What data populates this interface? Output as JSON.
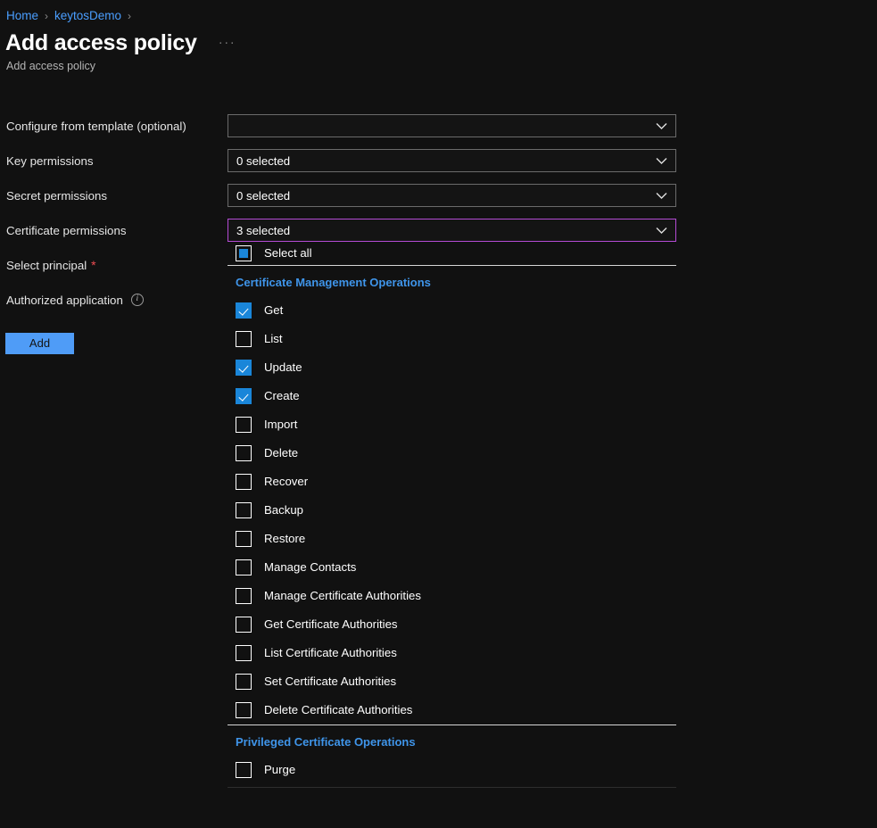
{
  "breadcrumb": {
    "items": [
      {
        "label": "Home"
      },
      {
        "label": "keytosDemo"
      }
    ],
    "separator": "›"
  },
  "header": {
    "title": "Add access policy",
    "subtitle": "Add access policy",
    "ellipsis": "···"
  },
  "form": {
    "rows": [
      {
        "label": "Configure from template (optional)",
        "value": "",
        "required": false,
        "has_info": false,
        "focused": false
      },
      {
        "label": "Key permissions",
        "value": "0 selected",
        "required": false,
        "has_info": false,
        "focused": false
      },
      {
        "label": "Secret permissions",
        "value": "0 selected",
        "required": false,
        "has_info": false,
        "focused": false
      },
      {
        "label": "Certificate permissions",
        "value": "3 selected",
        "required": false,
        "has_info": false,
        "focused": true
      },
      {
        "label": "Select principal",
        "value": null,
        "required": true,
        "has_info": false,
        "focused": false
      },
      {
        "label": "Authorized application",
        "value": null,
        "required": false,
        "has_info": true,
        "focused": false
      }
    ],
    "required_marker": "*",
    "info_glyph": "i",
    "add_label": "Add"
  },
  "certificate_permissions_panel": {
    "select_all": {
      "label": "Select all",
      "state": "indeterminate"
    },
    "groups": [
      {
        "title": "Certificate Management Operations",
        "options": [
          {
            "label": "Get",
            "checked": true
          },
          {
            "label": "List",
            "checked": false
          },
          {
            "label": "Update",
            "checked": true
          },
          {
            "label": "Create",
            "checked": true
          },
          {
            "label": "Import",
            "checked": false
          },
          {
            "label": "Delete",
            "checked": false
          },
          {
            "label": "Recover",
            "checked": false
          },
          {
            "label": "Backup",
            "checked": false
          },
          {
            "label": "Restore",
            "checked": false
          },
          {
            "label": "Manage Contacts",
            "checked": false
          },
          {
            "label": "Manage Certificate Authorities",
            "checked": false
          },
          {
            "label": "Get Certificate Authorities",
            "checked": false
          },
          {
            "label": "List Certificate Authorities",
            "checked": false
          },
          {
            "label": "Set Certificate Authorities",
            "checked": false
          },
          {
            "label": "Delete Certificate Authorities",
            "checked": false
          }
        ]
      },
      {
        "title": "Privileged Certificate Operations",
        "options": [
          {
            "label": "Purge",
            "checked": false
          }
        ]
      }
    ]
  },
  "colors": {
    "background": "#111111",
    "link": "#4a9eff",
    "group_title": "#3f95ea",
    "checkbox_checked": "#1a86d9",
    "focus_border": "#b44bd4",
    "primary_button": "#4f9cf7",
    "required_asterisk": "#ef4c52"
  }
}
